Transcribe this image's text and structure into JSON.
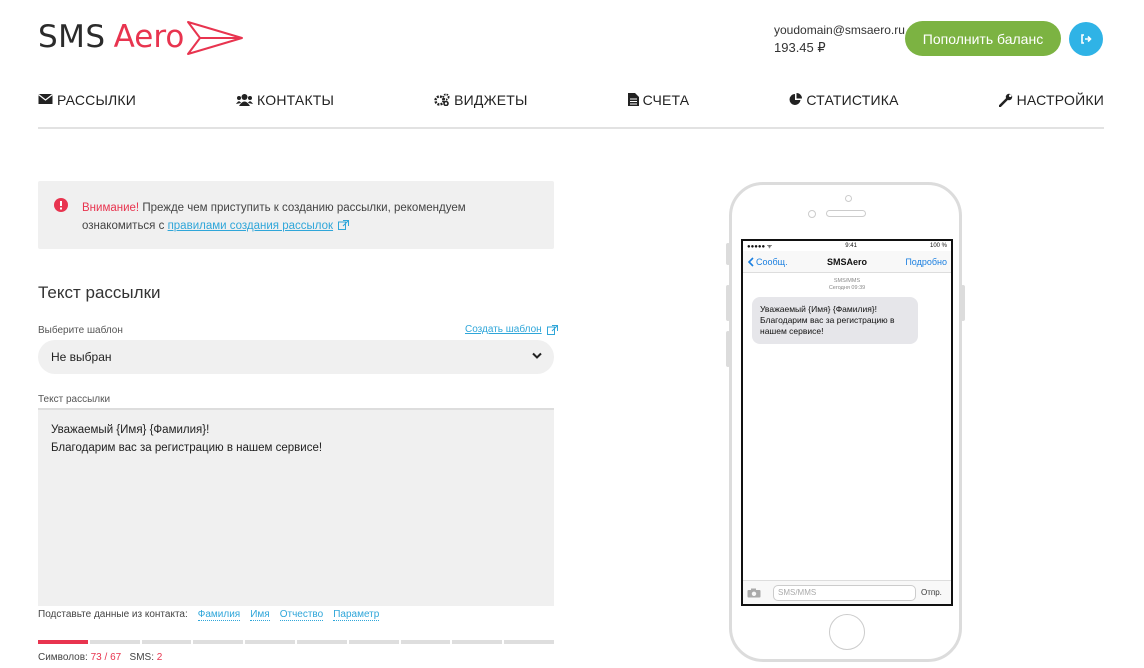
{
  "logo": {
    "part1": "SMS",
    "part2": "Aero"
  },
  "account": {
    "email": "youdomain@smsaero.ru",
    "balance": "193.45 ₽",
    "topup_label": "Пополнить баланс",
    "logout_icon": "logout-icon"
  },
  "nav": [
    {
      "label": "РАССЫЛКИ",
      "icon": "envelope-icon"
    },
    {
      "label": "КОНТАКТЫ",
      "icon": "users-icon"
    },
    {
      "label": "ВИДЖЕТЫ",
      "icon": "gears-icon"
    },
    {
      "label": "СЧЕТА",
      "icon": "document-icon"
    },
    {
      "label": "СТАТИСТИКА",
      "icon": "pie-chart-icon"
    },
    {
      "label": "НАСТРОЙКИ",
      "icon": "wrench-icon"
    }
  ],
  "alert": {
    "attention": "Внимание!",
    "text_before": " Прежде чем приступить к созданию рассылки, рекомендуем ознакомиться с ",
    "link": "правилами создания рассылок"
  },
  "form": {
    "section_title": "Текст рассылки",
    "template_label": "Выберите шаблон",
    "create_template": "Создать шаблон",
    "template_value": "Не выбран",
    "text_label": "Текст рассылки",
    "text_value": "Уважаемый {Имя} {Фамилия}!\nБлагодарим вас за регистрацию в нашем сервисе!",
    "subst_label": "Подставьте данные из контакта:",
    "subst_tags": [
      "Фамилия",
      "Имя",
      "Отчество",
      "Параметр"
    ],
    "progress_segments": 10,
    "progress_filled_fraction": 0.11,
    "chars_label": "Символов:",
    "chars_value": "73 / 67",
    "sms_label": "SMS:",
    "sms_value": "2"
  },
  "phone": {
    "carrier": "●●●●● ᯤ",
    "time": "9:41",
    "battery": "100 %",
    "back": "Сообщ.",
    "title": "SMSAero",
    "details": "Подробно",
    "meta1": "SMS/MMS",
    "meta2": "Сегодня 09:39",
    "bubble": "Уважаемый {Имя} {Фамилия}!\nБлагодарим вас за регистрацию в нашем сервисе!",
    "input_placeholder": "SMS/MMS",
    "send": "Отпр."
  },
  "colors": {
    "brand_red": "#e8344f",
    "green": "#7cb342",
    "blue": "#2fb3e6",
    "link": "#2fa6d9"
  }
}
